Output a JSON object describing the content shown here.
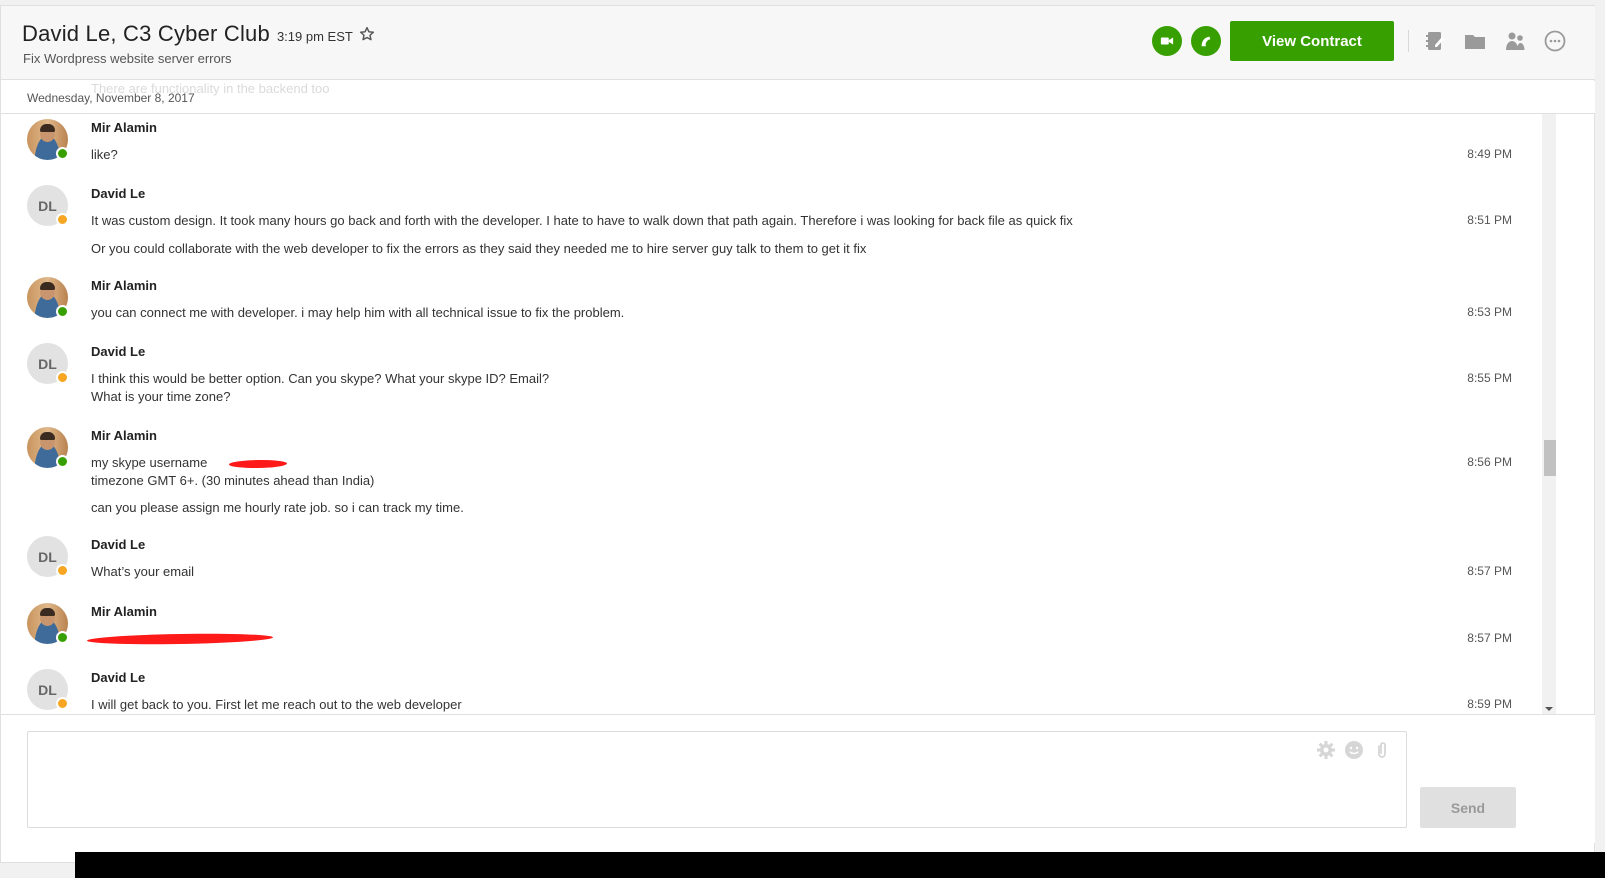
{
  "header": {
    "title": "David Le, C3 Cyber Club",
    "local_time": "3:19 pm EST",
    "subtitle": "Fix Wordpress website server errors",
    "view_contract_label": "View Contract",
    "icons": [
      "video-call-icon",
      "phone-call-icon",
      "notes-icon",
      "folder-icon",
      "people-icon",
      "more-options-icon"
    ],
    "accent_color": "#37a000"
  },
  "date_bar": {
    "faded_previous_text": "There are functionality in the backend too",
    "date": "Wednesday, November 8, 2017"
  },
  "messages": [
    {
      "sender": "Mir Alamin",
      "avatar": "photo",
      "status": "online",
      "lines": [
        "like?"
      ],
      "time": "8:49 PM"
    },
    {
      "sender": "David Le",
      "avatar": "DL",
      "status": "away",
      "lines": [
        "It was custom design. It took many hours go back and forth with the developer. I hate to have to walk down that path again. Therefore i was looking for back file as quick fix",
        "Or you could collaborate with the web developer to fix the errors as they said they needed me to hire server guy talk to them to get it fix"
      ],
      "time": "8:51 PM"
    },
    {
      "sender": "Mir Alamin",
      "avatar": "photo",
      "status": "online",
      "lines": [
        "you can connect me with developer. i may help him with all technical issue to fix the problem."
      ],
      "time": "8:53 PM"
    },
    {
      "sender": "David Le",
      "avatar": "DL",
      "status": "away",
      "lines": [
        "I think this would be better option. Can you skype? What your skype ID? Email?",
        "What is your time zone?"
      ],
      "time": "8:55 PM"
    },
    {
      "sender": "Mir Alamin",
      "avatar": "photo",
      "status": "online",
      "lines": [
        "my skype username",
        "timezone GMT 6+. (30 minutes ahead than India)",
        "can you please assign me hourly rate job. so i can track my time."
      ],
      "time": "8:56 PM"
    },
    {
      "sender": "David Le",
      "avatar": "DL",
      "status": "away",
      "lines": [
        "What’s your email"
      ],
      "time": "8:57 PM"
    },
    {
      "sender": "Mir Alamin",
      "avatar": "photo",
      "status": "online",
      "lines": [
        "[redacted]"
      ],
      "time": "8:57 PM"
    },
    {
      "sender": "David Le",
      "avatar": "DL",
      "status": "away",
      "lines": [
        "I will get back to you. First let me reach out to the web developer"
      ],
      "time": "8:59 PM"
    }
  ],
  "composer": {
    "placeholder": "",
    "value": "",
    "send_label": "Send",
    "icons": [
      "settings-icon",
      "emoji-icon",
      "attach-icon"
    ]
  }
}
